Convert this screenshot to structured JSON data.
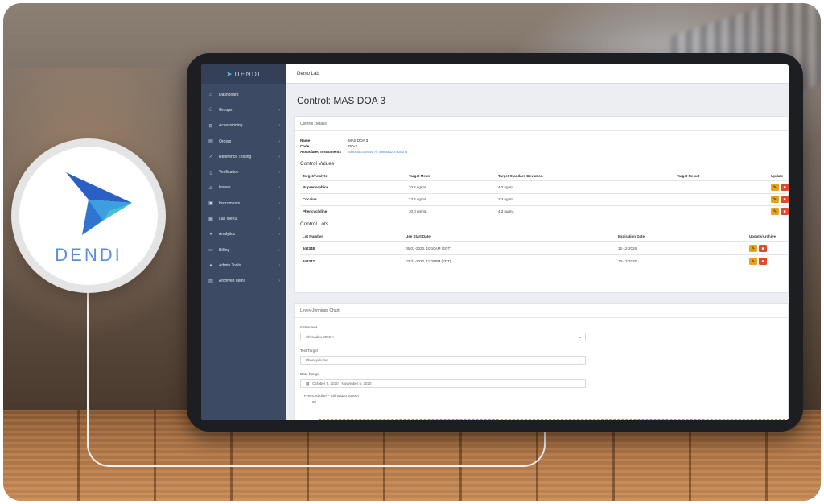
{
  "brand": {
    "logo_text": "DENDI",
    "app_name": "DENDI"
  },
  "colors": {
    "sidebar": "#3c4a63",
    "accent": "#4a86c8",
    "edit": "#e9a21a",
    "delete": "#e3472f",
    "logo": "#5a8fd6"
  },
  "sidebar": {
    "items": [
      {
        "label": "Dashboard",
        "icon": "home-icon"
      },
      {
        "label": "Groups",
        "icon": "groups-icon",
        "submenu": true
      },
      {
        "label": "Accessioning",
        "icon": "accessioning-icon",
        "submenu": true
      },
      {
        "label": "Orders",
        "icon": "orders-icon",
        "submenu": true
      },
      {
        "label": "Reference Testing",
        "icon": "external-link-icon",
        "submenu": true
      },
      {
        "label": "Verification",
        "icon": "document-icon",
        "submenu": true
      },
      {
        "label": "Issues",
        "icon": "warning-icon",
        "submenu": true
      },
      {
        "label": "Instruments",
        "icon": "instrument-icon",
        "submenu": true
      },
      {
        "label": "Lab Menu",
        "icon": "menu-grid-icon",
        "submenu": true
      },
      {
        "label": "Analytics",
        "icon": "analytics-icon",
        "submenu": true
      },
      {
        "label": "Billing",
        "icon": "billing-icon",
        "submenu": true
      },
      {
        "label": "Admin Tools",
        "icon": "lock-icon",
        "submenu": true
      },
      {
        "label": "Archived Items",
        "icon": "archive-icon",
        "submenu": true
      }
    ]
  },
  "topbar": {
    "lab_name": "Demo Lab"
  },
  "page": {
    "title": "Control: MAS DOA 3"
  },
  "control_details": {
    "heading": "Control Details",
    "name_label": "Name",
    "name_value": "MAS DOA 3",
    "code_label": "Code",
    "code_value": "DO-3",
    "instruments_label": "Associated Instruments",
    "instruments_value": "Shimadzu 8050 A, Shimadzu 8050 B"
  },
  "control_values": {
    "title": "Control Values",
    "headers": [
      "Target/Analyte",
      "Target Mean",
      "Target Standard Deviation",
      "Target Result",
      "Update"
    ],
    "rows": [
      {
        "analyte": "Buprenorphine",
        "mean": "20.4 ng/mL",
        "sd": "4.3 ng/mL"
      },
      {
        "analyte": "Cocaine",
        "mean": "23.4 ng/mL",
        "sd": "2.3 ng/mL"
      },
      {
        "analyte": "Phencyclidine",
        "mean": "30.0 ng/mL",
        "sd": "4.3 ng/mL"
      }
    ]
  },
  "control_lots": {
    "title": "Control Lots",
    "headers": [
      "Lot Number",
      "Use Start Date",
      "Expiration Date",
      "Update/Archive"
    ],
    "rows": [
      {
        "lot": "942348",
        "start": "05-01-2020, 10:10AM (EDT)",
        "expiration": "12-12-2026"
      },
      {
        "lot": "942347",
        "start": "03-31-2020, 11:09PM (EDT)",
        "expiration": "10-17-2025"
      }
    ]
  },
  "lj_chart": {
    "heading": "Levey-Jennings Chart",
    "instrument_label": "Instrument",
    "instrument_value": "Shimadzu 8050 A",
    "target_label": "Test Target",
    "target_value": "Phencyclidine",
    "date_label": "Date Range",
    "date_value": "October 5, 2020 - November 5, 2020",
    "series_label": "Phencyclidine – Shimadzu 8050 A",
    "axis_tick": "50"
  }
}
